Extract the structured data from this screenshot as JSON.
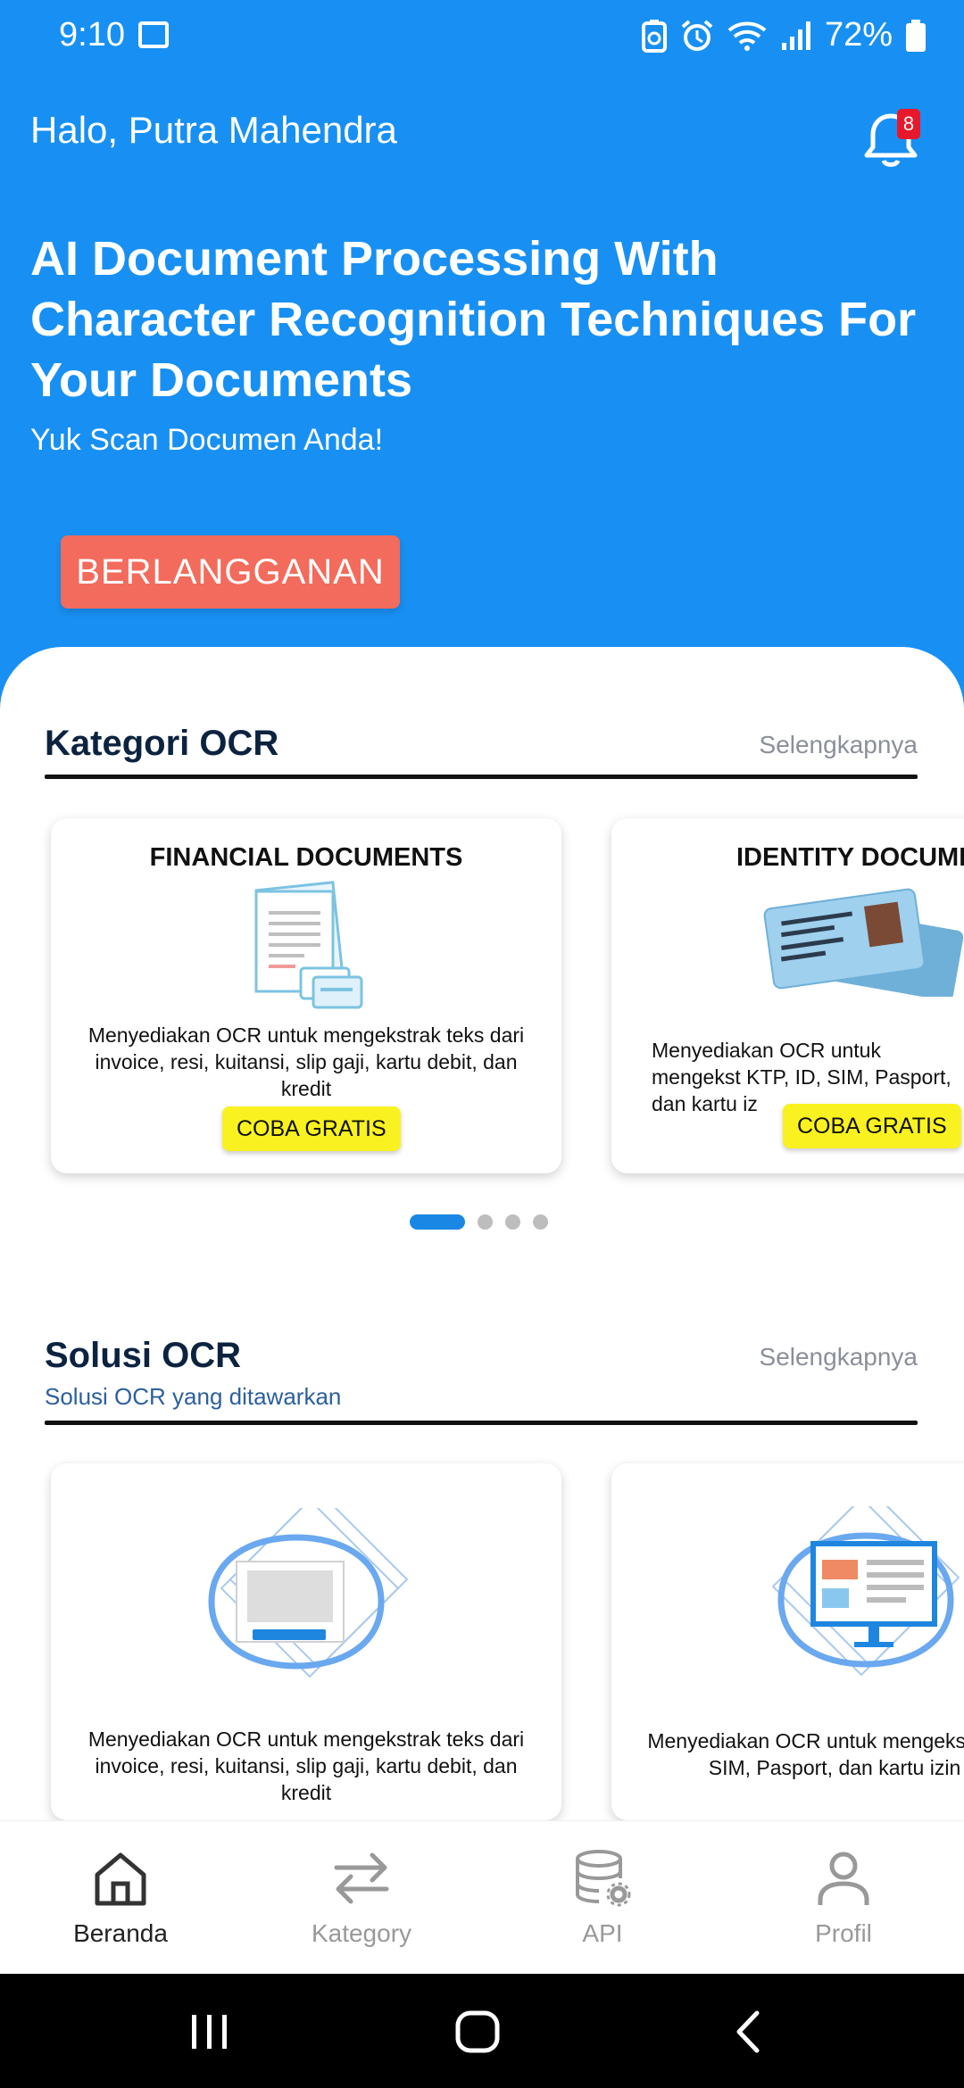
{
  "status_bar": {
    "time": "9:10",
    "battery": "72%"
  },
  "header": {
    "greeting": "Halo, Putra Mahendra",
    "notification_count": "8"
  },
  "hero": {
    "title": "AI Document Processing With Character Recognition Techniques For Your Documents",
    "subtitle": "Yuk Scan Documen Anda!",
    "cta_label": "BERLANGGANAN"
  },
  "kategori": {
    "title": "Kategori OCR",
    "more_label": "Selengkapnya",
    "cards": [
      {
        "title": "FINANCIAL DOCUMENTS",
        "description": "Menyediakan OCR untuk mengekstrak teks dari invoice, resi, kuitansi, slip gaji, kartu debit, dan kredit",
        "button": "COBA GRATIS"
      },
      {
        "title": "IDENTITY DOCUMEN",
        "description": "Menyediakan OCR untuk mengekst KTP, ID, SIM, Pasport, dan kartu iz",
        "button": "COBA GRATIS"
      }
    ],
    "pager": {
      "count": 4,
      "active_index": 0
    }
  },
  "solusi": {
    "title": "Solusi OCR",
    "subtitle": "Solusi OCR yang ditawarkan",
    "more_label": "Selengkapnya",
    "cards": [
      {
        "description": "Menyediakan OCR untuk mengekstrak teks dari invoice, resi, kuitansi, slip gaji, kartu debit, dan kredit"
      },
      {
        "description": "Menyediakan OCR untuk mengekstra ID, SIM, Pasport, dan kartu izin"
      }
    ]
  },
  "bottom_nav": {
    "items": [
      {
        "label": "Beranda",
        "icon": "home-icon",
        "active": true
      },
      {
        "label": "Kategory",
        "icon": "swap-arrows-icon",
        "active": false
      },
      {
        "label": "API",
        "icon": "database-gear-icon",
        "active": false
      },
      {
        "label": "Profil",
        "icon": "user-icon",
        "active": false
      }
    ]
  },
  "colors": {
    "primary": "#1890f3",
    "cta": "#f36b5c",
    "try_button": "#f9f220",
    "badge": "#e8182b"
  }
}
